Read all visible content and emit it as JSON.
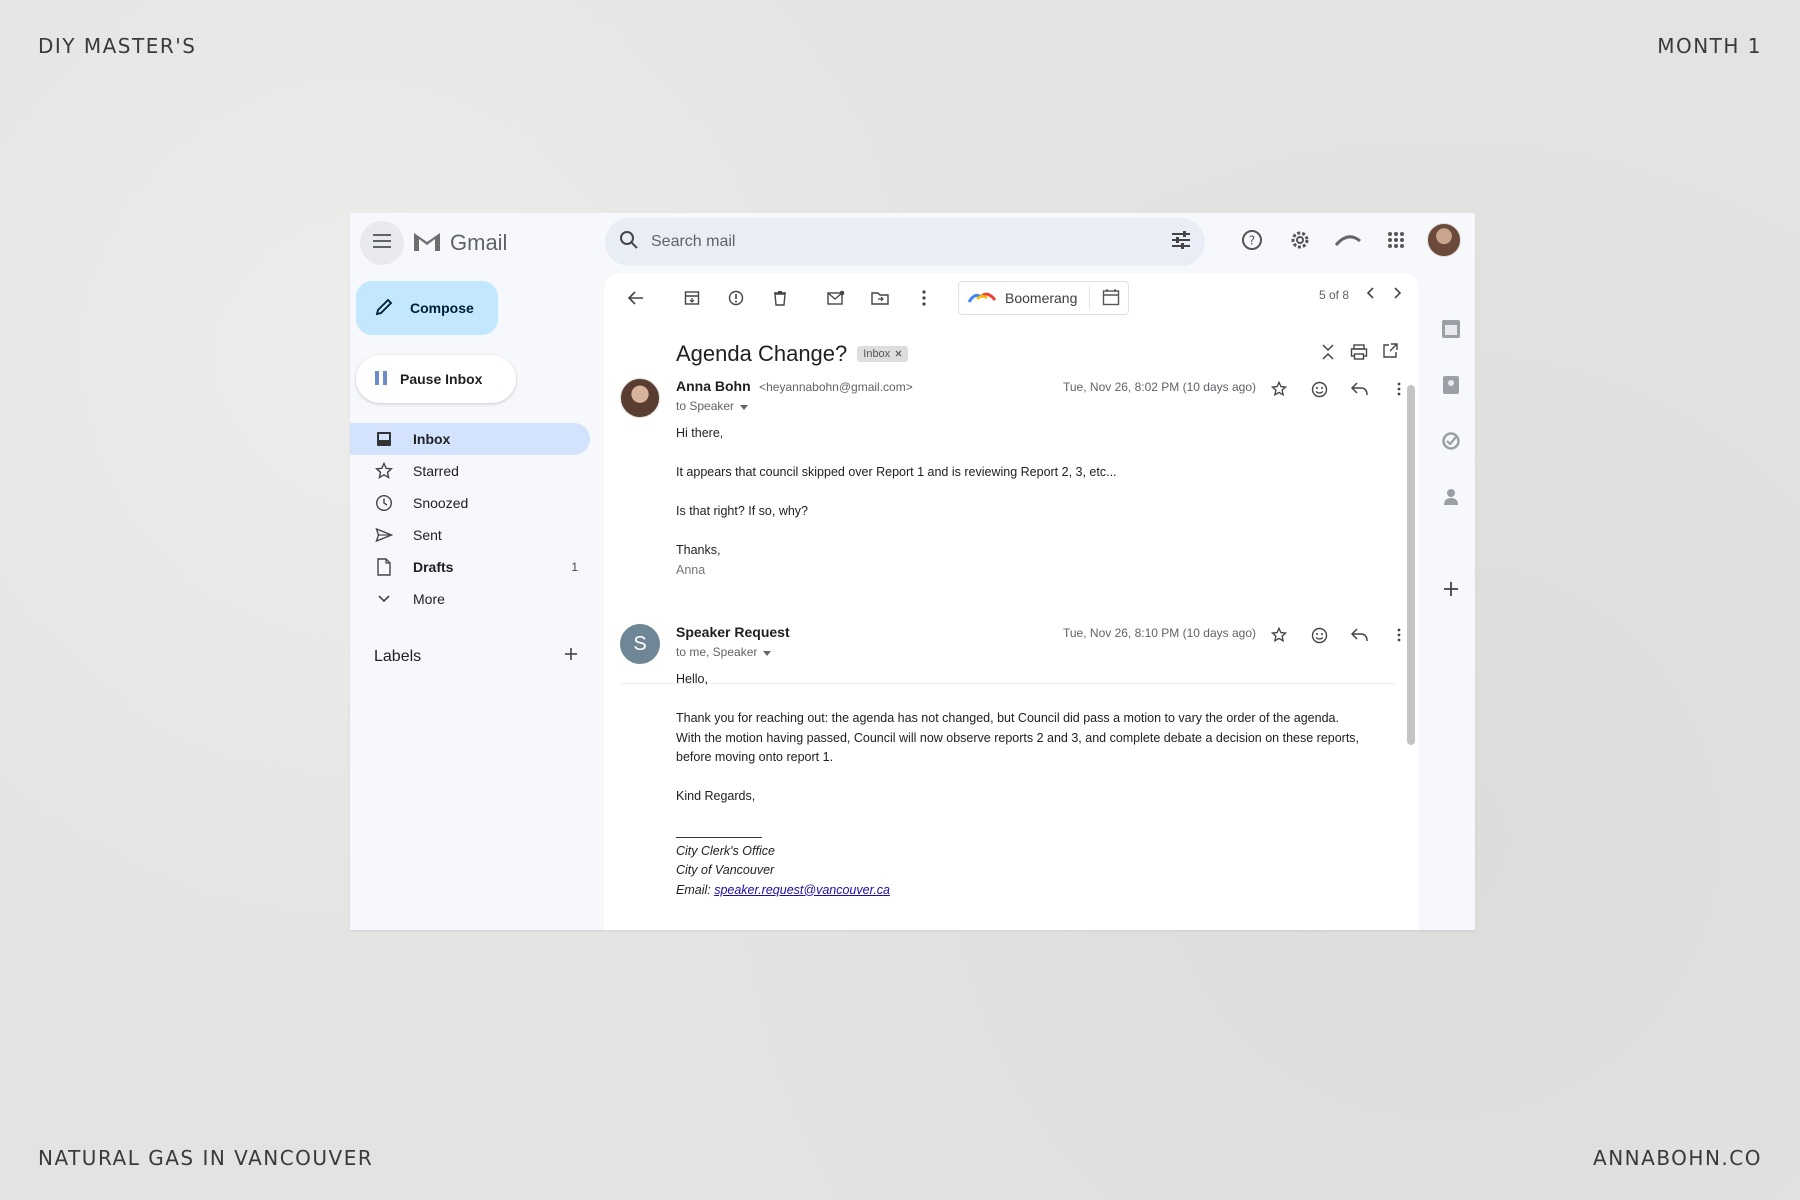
{
  "corners": {
    "top_left": "DIY MASTER'S",
    "top_right": "MONTH 1",
    "bottom_left": "NATURAL GAS IN VANCOUVER",
    "bottom_right": "ANNABOHN.CO"
  },
  "app": {
    "name": "Gmail"
  },
  "search": {
    "placeholder": "Search mail"
  },
  "sidebar": {
    "compose_label": "Compose",
    "pause_label": "Pause Inbox",
    "items": [
      {
        "label": "Inbox",
        "count": ""
      },
      {
        "label": "Starred",
        "count": ""
      },
      {
        "label": "Snoozed",
        "count": ""
      },
      {
        "label": "Sent",
        "count": ""
      },
      {
        "label": "Drafts",
        "count": "1"
      },
      {
        "label": "More",
        "count": ""
      }
    ],
    "labels_heading": "Labels"
  },
  "toolbar": {
    "boomerang_label": "Boomerang",
    "pager": "5 of 8"
  },
  "thread": {
    "subject": "Agenda Change?",
    "label_chip": "Inbox",
    "messages": [
      {
        "sender": "Anna Bohn",
        "email": "<heyannabohn@gmail.com>",
        "to": "to Speaker",
        "date": "Tue, Nov 26, 8:02 PM (10 days ago)",
        "greeting": "Hi there,",
        "paragraphs": [
          "It appears that council skipped over Report 1 and is reviewing Report 2, 3, etc...",
          "Is that right? If so, why?"
        ],
        "signoff": "Thanks,",
        "signature": "Anna"
      },
      {
        "sender": "Speaker Request",
        "avatar_letter": "S",
        "to": "to me, Speaker",
        "date": "Tue, Nov 26, 8:10 PM (10 days ago)",
        "greeting": "Hello,",
        "paragraph_lines": [
          "Thank you for reaching out: the agenda has not changed, but Council did pass a motion to vary the order of the agenda.",
          "With the motion having passed, Council will now observe reports 2 and 3, and complete debate a decision on these reports,",
          "before moving onto report 1."
        ],
        "signoff": "Kind Regards,",
        "sig_office": "City Clerk's Office",
        "sig_city": "City of Vancouver",
        "sig_email_prefix": "Email: ",
        "sig_email": "speaker.request@vancouver.ca"
      }
    ]
  },
  "colors": {
    "compose_bg": "#c2e7ff",
    "inbox_active_bg": "#d3e3fd",
    "search_bg": "#e9eef6",
    "shell_bg": "#f6f8fc",
    "page_bg": "#e3e3e1",
    "avatar_s": "#6f8696"
  }
}
